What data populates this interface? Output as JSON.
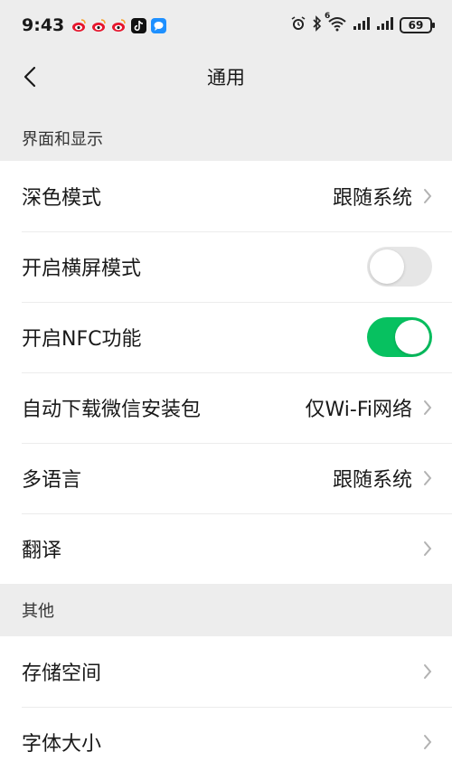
{
  "status_bar": {
    "time": "9:43",
    "battery": "69",
    "network_label": "6"
  },
  "nav": {
    "title": "通用"
  },
  "sections": {
    "display": {
      "header": "界面和显示",
      "dark_mode": {
        "label": "深色模式",
        "value": "跟随系统"
      },
      "landscape": {
        "label": "开启横屏模式",
        "enabled": false
      },
      "nfc": {
        "label": "开启NFC功能",
        "enabled": true
      },
      "auto_download": {
        "label": "自动下载微信安装包",
        "value": "仅Wi-Fi网络"
      },
      "language": {
        "label": "多语言",
        "value": "跟随系统"
      },
      "translate": {
        "label": "翻译"
      }
    },
    "other": {
      "header": "其他",
      "storage": {
        "label": "存储空间"
      },
      "font_size": {
        "label": "字体大小"
      }
    }
  },
  "colors": {
    "accent_green": "#07c160",
    "background": "#ededed",
    "toggle_off": "#e6e6e6"
  }
}
